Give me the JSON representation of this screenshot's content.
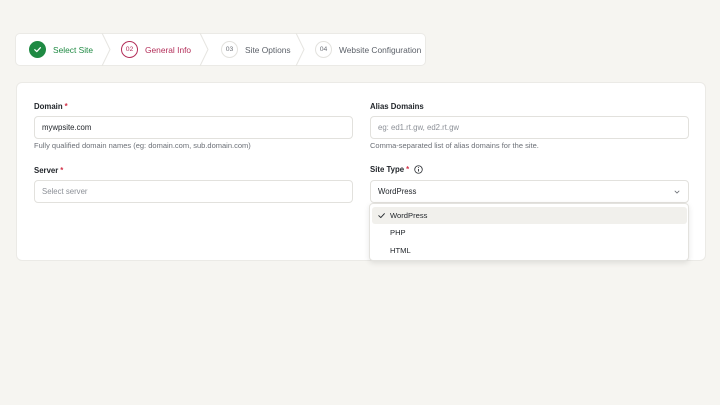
{
  "stepper": {
    "steps": [
      {
        "index": "✓",
        "label": "Select Site",
        "state": "done"
      },
      {
        "index": "02",
        "label": "General Info",
        "state": "active"
      },
      {
        "index": "03",
        "label": "Site Options",
        "state": "todo"
      },
      {
        "index": "04",
        "label": "Website Configuration",
        "state": "todo"
      }
    ]
  },
  "form": {
    "domain": {
      "label": "Domain",
      "required_mark": "*",
      "value": "mywpsite.com",
      "help": "Fully qualified domain names (eg: domain.com, sub.domain.com)"
    },
    "alias_domains": {
      "label": "Alias Domains",
      "placeholder": "eg: ed1.rt.gw, ed2.rt.gw",
      "help": "Comma-separated list of alias domains for the site."
    },
    "server": {
      "label": "Server",
      "required_mark": "*",
      "placeholder": "Select server"
    },
    "site_type": {
      "label": "Site Type",
      "required_mark": "*",
      "value": "WordPress",
      "options": [
        "WordPress",
        "PHP",
        "HTML"
      ],
      "selected_index": 0
    }
  },
  "colors": {
    "success": "#1f8a43",
    "accent": "#b32e59",
    "required": "#d3344a",
    "background": "#f6f5f1"
  }
}
